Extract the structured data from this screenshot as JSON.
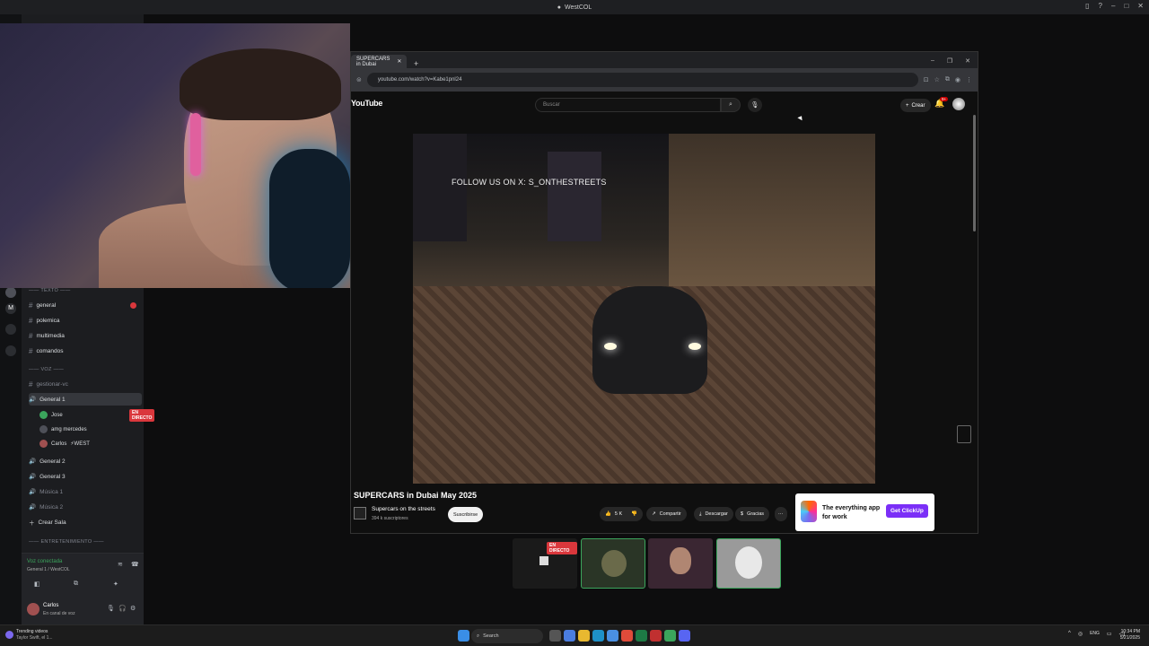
{
  "window": {
    "title": "WestCOL"
  },
  "discord": {
    "categories": {
      "text": "TEXTO",
      "voice": "VOZ",
      "entertainment": "ENTRETENIMIENTO"
    },
    "text_channels": [
      "general",
      "polemica",
      "multimedia",
      "comandos"
    ],
    "voice_channels": {
      "manage": "gestionar-vc",
      "selected": "General 1",
      "users": [
        {
          "name": "Jose",
          "live": "EN DIRECTO"
        },
        {
          "name": "amg mercedes"
        },
        {
          "name": "Carlos",
          "tag": "⚡WEST"
        }
      ],
      "others": [
        "General 2",
        "General 3",
        "Música 1",
        "Música 2"
      ],
      "create": "Crear Sala"
    },
    "voice_connected": {
      "status": "Voz conectada",
      "channel": "General 1 / WestCOL"
    },
    "user": {
      "name": "Carlos",
      "status": "En canal de voz"
    }
  },
  "browser": {
    "tab_title": "SUPERCARS in Dubai",
    "url": "youtube.com/watch?v=Kabe1pnl24"
  },
  "youtube": {
    "logo": "YouTube",
    "search_placeholder": "Buscar",
    "create_label": "Crear",
    "notification_count": "9+",
    "overlay_text": "FOLLOW US ON X: S_ONTHESTREETS",
    "video_title": "SUPERCARS in Dubai May 2025",
    "channel_name": "Supercars on the streets",
    "subscribers": "394 k suscriptores",
    "subscribe_label": "Suscribirse",
    "like_count": "5 K",
    "share_label": "Compartir",
    "download_label": "Descargar",
    "thanks_label": "Gracias",
    "ad": {
      "text_line1": "The everything app",
      "text_line2": "for work",
      "button": "Get ClickUp"
    }
  },
  "stream_tiles": {
    "live_badge": "EN DIRECTO"
  },
  "taskbar": {
    "trending_title": "Trending videos",
    "trending_sub": "Taylor Swift, el 1...",
    "search_label": "Search",
    "lang": "ENG",
    "time": "10:34 PM",
    "date": "5/21/2025"
  },
  "colors": {
    "accent_green": "#3ba55c",
    "live_red": "#da373c",
    "yt_red": "#cc0000",
    "clickup_purple": "#7b2ff7"
  }
}
